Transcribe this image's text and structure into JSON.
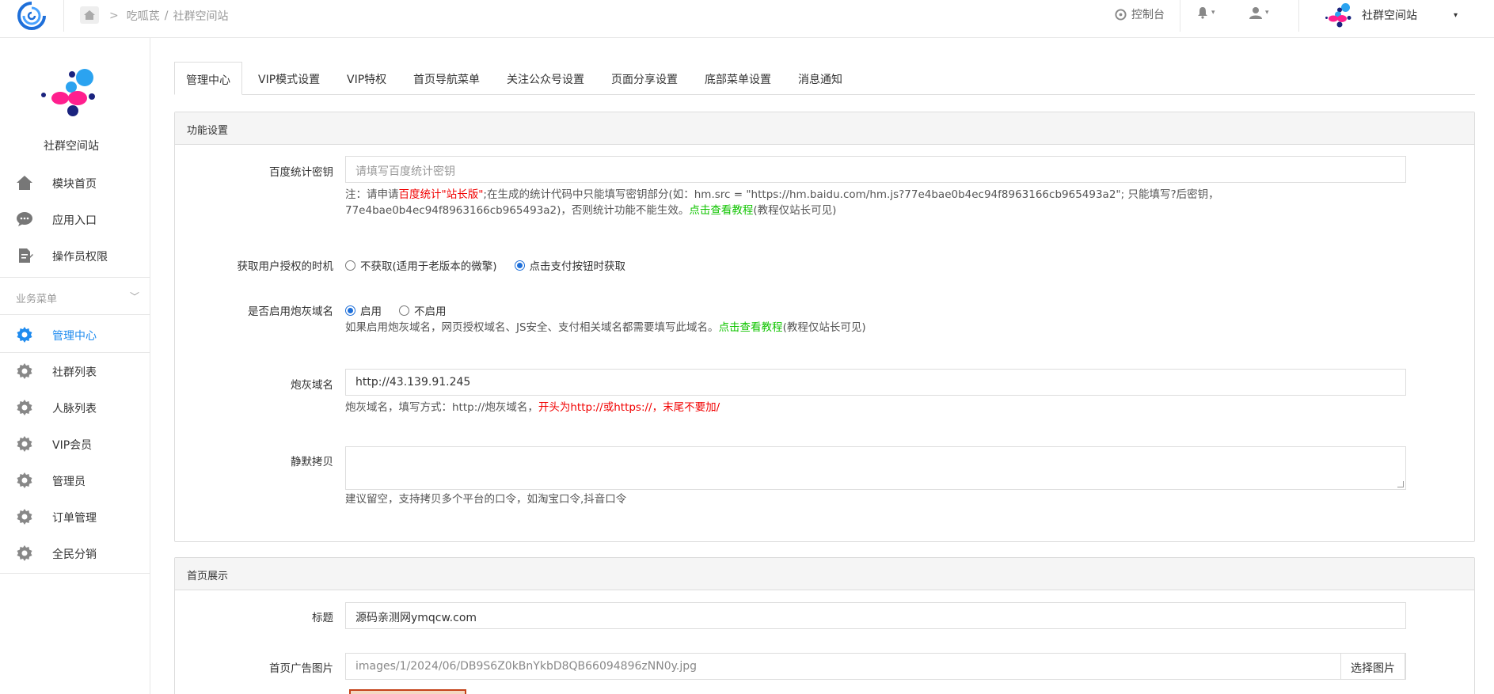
{
  "topbar": {
    "breadcrumb_sep": ">",
    "breadcrumb_app": "吃呱茋",
    "breadcrumb_divider": "/",
    "breadcrumb_page": "社群空间站",
    "console_label": "控制台",
    "site_name": "社群空间站",
    "caret": "▾"
  },
  "sidebar": {
    "site_name": "社群空间站",
    "top_items": [
      {
        "label": "模块首页",
        "icon": "home-icon"
      },
      {
        "label": "应用入口",
        "icon": "chat-icon"
      },
      {
        "label": "操作员权限",
        "icon": "document-edit-icon"
      }
    ],
    "group_label": "业务菜单",
    "group_chevron": "﹀",
    "group_items": [
      {
        "label": "管理中心",
        "icon": "gear-icon",
        "active": true
      },
      {
        "label": "社群列表",
        "icon": "gear-icon"
      },
      {
        "label": "人脉列表",
        "icon": "gear-icon"
      },
      {
        "label": "VIP会员",
        "icon": "gear-icon"
      },
      {
        "label": "管理员",
        "icon": "gear-icon"
      },
      {
        "label": "订单管理",
        "icon": "gear-icon"
      },
      {
        "label": "全民分销",
        "icon": "gear-icon"
      }
    ]
  },
  "tabs": [
    "管理中心",
    "VIP模式设置",
    "VIP特权",
    "首页导航菜单",
    "关注公众号设置",
    "页面分享设置",
    "底部菜单设置",
    "消息通知"
  ],
  "panel_features": {
    "title": "功能设置",
    "baidu_label": "百度统计密钥",
    "baidu_placeholder": "请填写百度统计密钥",
    "baidu_help_1": "注：请申请",
    "baidu_help_red": "百度统计\"站长版\"",
    "baidu_help_2": ";在生成的统计代码中只能填写密钥部分(如：hm.src = \"https://hm.baidu.com/hm.js?77e4bae0b4ec94f8963166cb965493a2\"; 只能填写?后密钥，",
    "baidu_help_3": "77e4bae0b4ec94f8963166cb965493a2)，否则统计功能不能生效。",
    "baidu_help_link": "点击查看教程",
    "baidu_help_4": "(教程仅站长可见)",
    "auth_label": "获取用户授权的时机",
    "auth_options": [
      "不获取(适用于老版本的微擎)",
      "点击支付按钮时获取"
    ],
    "cannon_enable_label": "是否启用炮灰域名",
    "cannon_options": [
      "启用",
      "不启用"
    ],
    "cannon_help_1": "如果启用炮灰域名，网页授权域名、JS安全、支付相关域名都需要填写此域名。",
    "cannon_help_link": "点击查看教程",
    "cannon_help_2": "(教程仅站长可见)",
    "cannon_domain_label": "炮灰域名",
    "cannon_domain_value": "http://43.139.91.245",
    "cannon_domain_help_1": "炮灰域名，填写方式：http://炮灰域名，",
    "cannon_domain_help_red": "开头为http://或https://，末尾不要加/",
    "silent_copy_label": "静默拷贝",
    "silent_copy_help": "建议留空，支持拷贝多个平台的口令，如淘宝口令,抖音口令"
  },
  "panel_home": {
    "title": "首页展示",
    "title_label": "标题",
    "title_value": "源码亲测网ymqcw.com",
    "ad_label": "首页广告图片",
    "ad_value": "images/1/2024/06/DB9S6Z0kBnYkbD8QB66094896zNN0y.jpg",
    "ad_button": "选择图片"
  },
  "colors": {
    "accent": "#1e8bef",
    "warning_red": "#f10000",
    "link_green": "#10c400",
    "radio_blue": "#1e6fd9"
  }
}
